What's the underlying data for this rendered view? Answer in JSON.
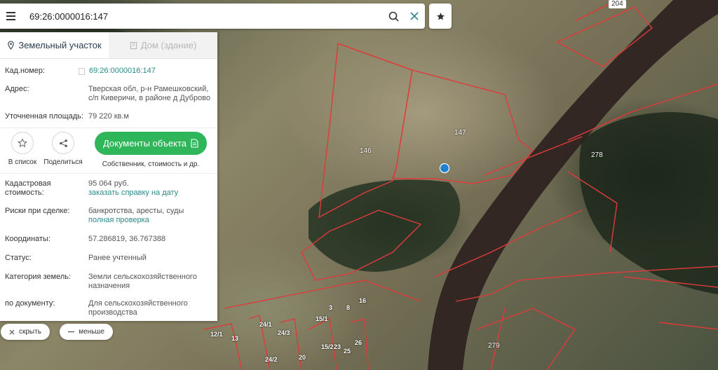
{
  "search": {
    "value": "69:26:0000016:147"
  },
  "tabs": [
    {
      "label": "Земельный участок",
      "icon": "map-pin-icon",
      "active": true
    },
    {
      "label": "Дом (здание)",
      "icon": "building-icon",
      "active": false
    }
  ],
  "fields": {
    "cad_label": "Кад.номер:",
    "cad_value": "69:26:0000016:147",
    "address_label": "Адрес:",
    "address_value": "Тверская обл, р-н Рамешковский, с/п Киверичи, в районе д Дуброво",
    "area_label": "Уточненная площадь:",
    "area_value": "79 220 кв.м",
    "cost_label": "Кадастровая стоимость:",
    "cost_value": "95 064 руб.",
    "cost_link": "заказать справку на дату",
    "risks_label": "Риски при сделке:",
    "risks_value": "банкротства, аресты, суды",
    "risks_link": "полная проверка",
    "coords_label": "Координаты:",
    "coords_value": "57.286819, 36.767388",
    "status_label": "Статус:",
    "status_value": "Ранее учтенный",
    "category_label": "Категория земель:",
    "category_value": "Земли сельскохозяйственного назначения",
    "doc_label": "по документу:",
    "doc_value": "Для сельскохозяйственного производства"
  },
  "actions": {
    "favorite_label": "В список",
    "share_label": "Поделиться",
    "docs_button": "Документы объекта",
    "docs_sub": "Собственник, стоимость и др."
  },
  "chips": {
    "hide": "скрыть",
    "less": "меньше"
  },
  "map": {
    "road_number": "204",
    "parcels": [
      "147",
      "146",
      "278",
      "279",
      "3",
      "8",
      "16",
      "15/1",
      "24/1",
      "24/2",
      "13",
      "23",
      "25",
      "26",
      "15/2",
      "20",
      "12/1",
      "24/3"
    ],
    "accent_boundary": "#e03a3a",
    "marker_color": "#1f7fd0"
  },
  "colors": {
    "accent_green": "#2fb55a",
    "link_teal": "#2b8a8a"
  }
}
